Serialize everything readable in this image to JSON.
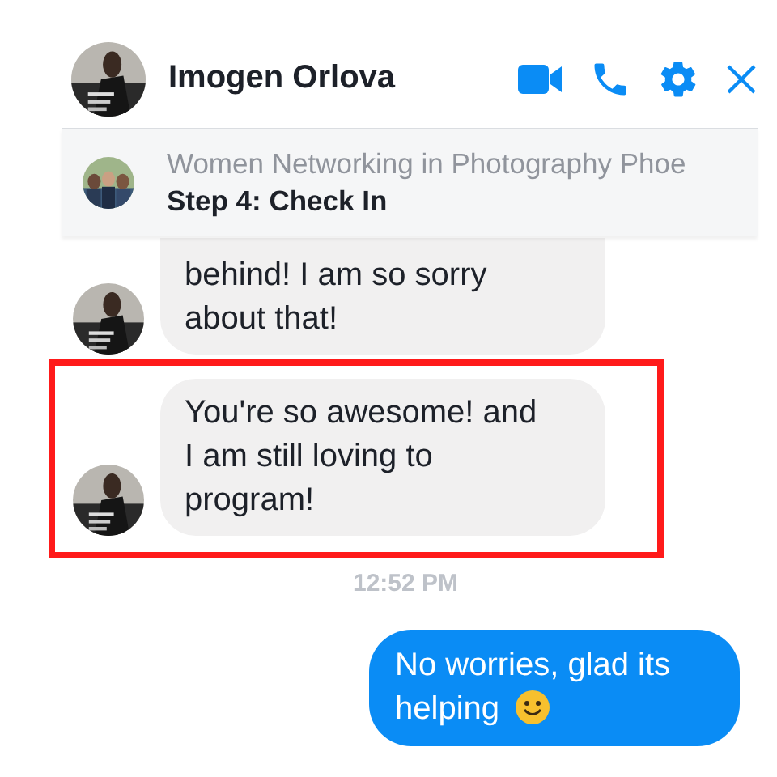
{
  "header": {
    "contact_name": "Imogen Orlova"
  },
  "pinned": {
    "group_name": "Women Networking in Photography Phoe",
    "subtitle": "Step 4: Check In"
  },
  "messages": [
    {
      "kind": "received",
      "text": "behind! I am so sorry about that!",
      "highlighted": false
    },
    {
      "kind": "received",
      "text": "You're so awesome! and I am still loving to program!",
      "highlighted": true
    },
    {
      "kind": "time",
      "text": "12:52 PM",
      "highlighted": false
    },
    {
      "kind": "sent",
      "text": "No worries, glad its helping",
      "smiley": true,
      "highlighted": false
    }
  ]
}
